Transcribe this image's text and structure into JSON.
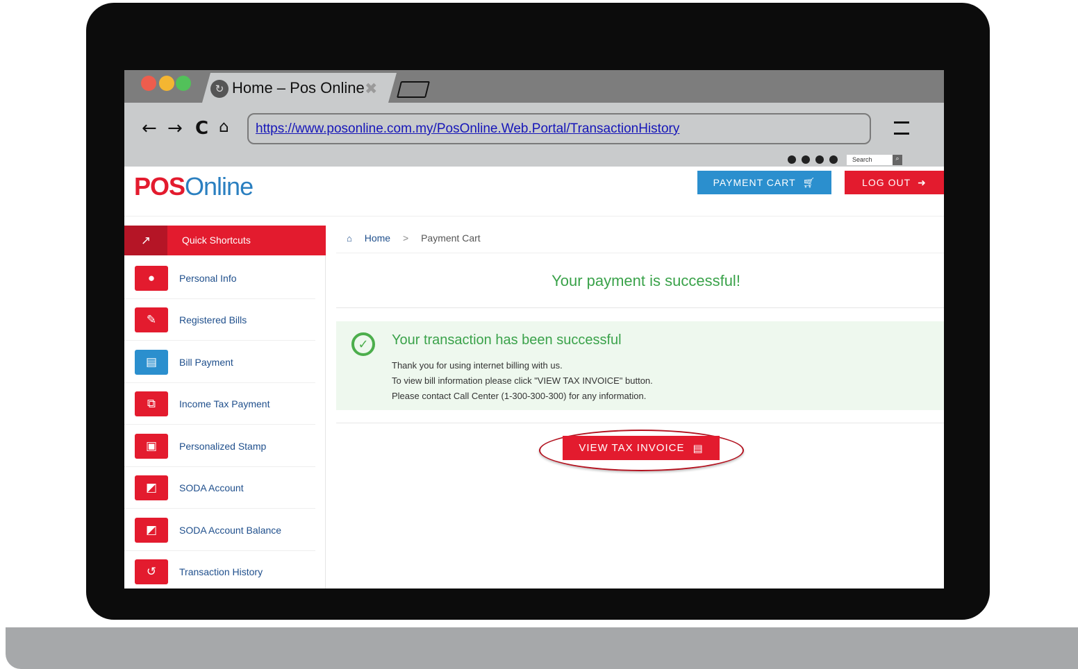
{
  "browser": {
    "tab_title": "Home – Pos Online",
    "url": "https://www.posonline.com.my/PosOnline.Web.Portal/TransactionHistory",
    "search_placeholder": "Search"
  },
  "site": {
    "logo_pos": "POS",
    "logo_online": "Online",
    "payment_cart_label": "PAYMENT CART",
    "logout_label": "LOG OUT"
  },
  "sidebar": {
    "header_label": "Quick Shortcuts",
    "items": [
      {
        "label": "Personal Info",
        "icon": "user-icon"
      },
      {
        "label": "Registered Bills",
        "icon": "edit-icon"
      },
      {
        "label": "Bill Payment",
        "icon": "document-icon"
      },
      {
        "label": "Income Tax Payment",
        "icon": "code-file-icon"
      },
      {
        "label": "Personalized Stamp",
        "icon": "id-card-icon"
      },
      {
        "label": "SODA Account",
        "icon": "image-file-icon"
      },
      {
        "label": "SODA Account Balance",
        "icon": "image-file-icon"
      },
      {
        "label": "Transaction History",
        "icon": "history-icon"
      }
    ]
  },
  "breadcrumb": {
    "home": "Home",
    "separator": ">",
    "current": "Payment Cart"
  },
  "content": {
    "headline": "Your payment is successful!",
    "success_title": "Your transaction has been successful",
    "lines": [
      "Thank you for using internet billing with us.",
      "To view bill information please click \"VIEW TAX INVOICE\" button.",
      "Please contact Call Center (1-300-300-300) for any information."
    ],
    "invoice_button": "VIEW TAX INVOICE"
  },
  "colors": {
    "brand_red": "#e31b2e",
    "brand_blue": "#2b8fce",
    "success_green": "#3aa24a",
    "link_blue": "#1f4f8c"
  }
}
